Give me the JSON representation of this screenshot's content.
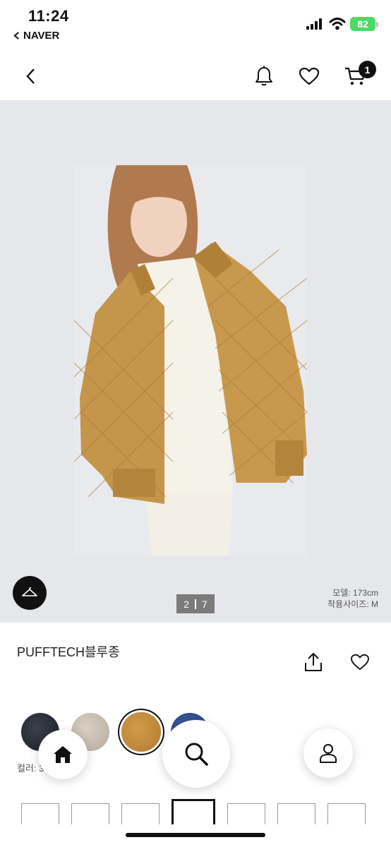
{
  "status": {
    "time": "11:24",
    "back_app": "NAVER",
    "battery": "82"
  },
  "header": {
    "cart_count": "1"
  },
  "gallery": {
    "current": "2",
    "total": "7",
    "model_height": "모델: 173cm",
    "wear_size": "착용사이즈: M"
  },
  "product": {
    "title": "PUFFTECH블루종",
    "color_label": "컬러: 3 BROWN"
  },
  "colors": [
    "#1d2029",
    "#c6bcaf",
    "#c68a3d",
    "#2a4586"
  ],
  "size_count": 7
}
